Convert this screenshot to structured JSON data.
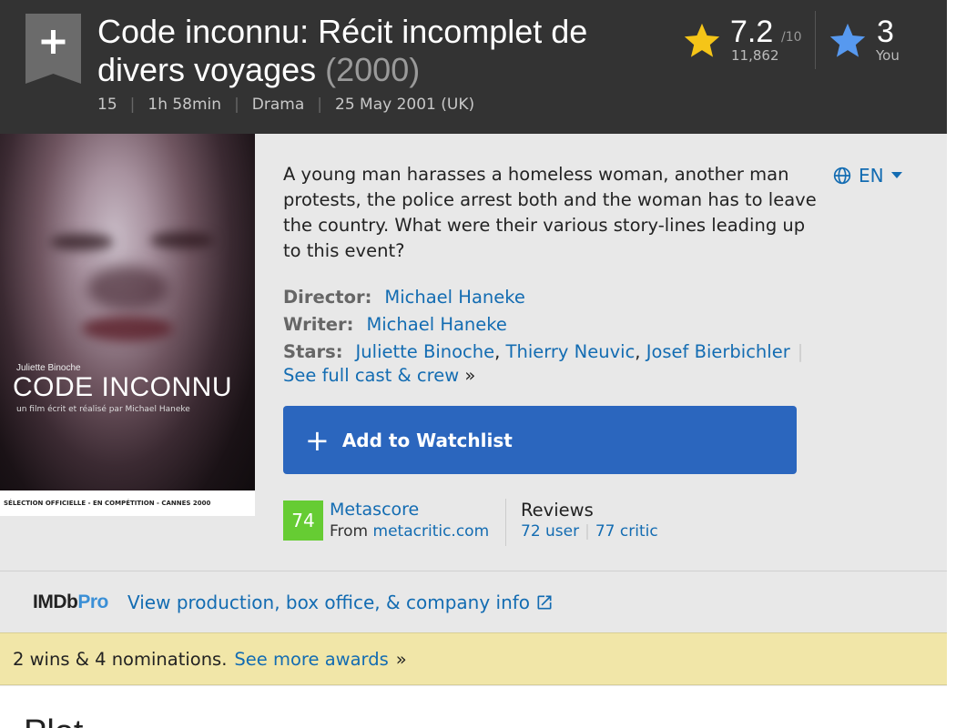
{
  "header": {
    "title": "Code inconnu: Récit incomplet de divers voyages",
    "year": "(2000)",
    "certificate": "15",
    "runtime": "1h 58min",
    "genre": "Drama",
    "release": "25 May 2001 (UK)",
    "rating_value": "7.2",
    "rating_outof": "/10",
    "rating_count": "11,862",
    "your_rating": "3",
    "your_label": "You"
  },
  "poster": {
    "actress": "Juliette Binoche",
    "title": "CODE INCONNU",
    "credit": "un film écrit et réalisé par Michael Haneke",
    "bottom": "SÉLECTION OFFICIELLE - EN COMPÉTITION - CANNES 2000"
  },
  "summary": "A young man harasses a homeless woman, another man protests, the police arrest both and the woman has to leave the country. What were their various story-lines leading up to this event?",
  "language": "EN",
  "credits": {
    "director_label": "Director:",
    "director": "Michael Haneke",
    "writer_label": "Writer:",
    "writer": "Michael Haneke",
    "stars_label": "Stars:",
    "stars": [
      "Juliette Binoche",
      "Thierry Neuvic",
      "Josef Bierbichler"
    ],
    "full_cast": "See full cast & crew",
    "chevron": "»"
  },
  "watchlist_label": "Add to Watchlist",
  "metascore": {
    "score": "74",
    "label": "Metascore",
    "from": "From",
    "site": "metacritic.com"
  },
  "reviews": {
    "label": "Reviews",
    "user": "72 user",
    "critic": "77 critic"
  },
  "pro": {
    "logo_a": "IMDb",
    "logo_b": "Pro",
    "link": "View production, box office, & company info"
  },
  "awards": {
    "text": "2 wins & 4 nominations.",
    "link": "See more awards",
    "chevron": "»"
  },
  "plot_title": "Plot",
  "colors": {
    "header_bg": "#333333",
    "link": "#136cb2",
    "watchlist": "#2b66be",
    "metascore": "#66cc33",
    "awards_bg": "#f1e6a8"
  }
}
